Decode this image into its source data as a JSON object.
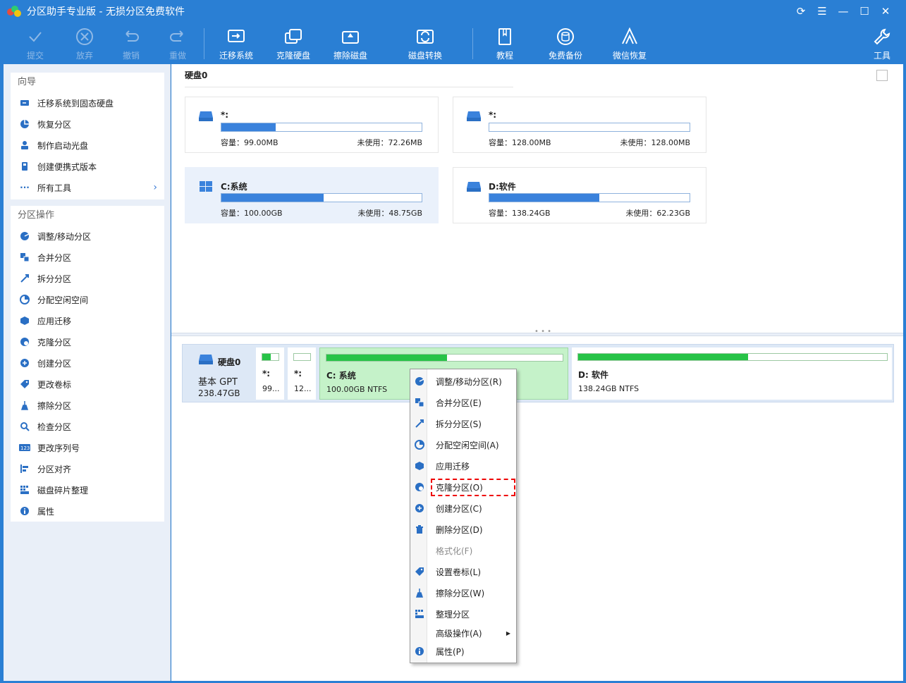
{
  "window": {
    "title": "分区助手专业版 - 无损分区免费软件"
  },
  "toolbar": {
    "commit": "提交",
    "discard": "放弃",
    "undo": "撤销",
    "redo": "重做",
    "migrate": "迁移系统",
    "clone": "克隆硬盘",
    "wipe": "擦除磁盘",
    "convert": "磁盘转换",
    "tutorial": "教程",
    "backup": "免费备份",
    "wechat": "微信恢复",
    "tools": "工具"
  },
  "sidebar": {
    "wizard_title": "向导",
    "wizard_items": [
      "迁移系统到固态硬盘",
      "恢复分区",
      "制作启动光盘",
      "创建便携式版本",
      "所有工具"
    ],
    "ops_title": "分区操作",
    "ops_items": [
      "调整/移动分区",
      "合并分区",
      "拆分分区",
      "分配空闲空间",
      "应用迁移",
      "克隆分区",
      "创建分区",
      "更改卷标",
      "擦除分区",
      "检查分区",
      "更改序列号",
      "分区对齐",
      "磁盘碎片整理",
      "属性"
    ]
  },
  "main": {
    "disk_title": "硬盘0",
    "partitions": [
      {
        "name": "*:",
        "used_fraction": 0.27,
        "capacity_label": "容量：99.00MB",
        "free_label": "未使用：72.26MB"
      },
      {
        "name": "*:",
        "used_fraction": 0.0,
        "capacity_label": "容量：128.00MB",
        "free_label": "未使用：128.00MB"
      },
      {
        "name": "C:系统",
        "used_fraction": 0.51,
        "capacity_label": "容量：100.00GB",
        "free_label": "未使用：48.75GB"
      },
      {
        "name": "D:软件",
        "used_fraction": 0.55,
        "capacity_label": "容量：138.24GB",
        "free_label": "未使用：62.23GB"
      }
    ]
  },
  "diskmap": {
    "name": "硬盘0",
    "type": "基本 GPT",
    "size": "238.47GB",
    "segments": [
      {
        "name": "*:",
        "info": "99...",
        "used_fraction": 0.5
      },
      {
        "name": "*:",
        "info": "12...",
        "used_fraction": 0.0
      },
      {
        "name": "C: 系统",
        "info": "100.00GB NTFS",
        "used_fraction": 0.51
      },
      {
        "name": "D: 软件",
        "info": "138.24GB NTFS",
        "used_fraction": 0.55
      }
    ]
  },
  "context_menu": {
    "items": [
      "调整/移动分区(R)",
      "合并分区(E)",
      "拆分分区(S)",
      "分配空闲空间(A)",
      "应用迁移",
      "克隆分区(O)",
      "创建分区(C)",
      "删除分区(D)",
      "格式化(F)",
      "设置卷标(L)",
      "擦除分区(W)",
      "整理分区",
      "高级操作(A)",
      "属性(P)"
    ]
  },
  "colors": {
    "accent": "#2a7fd4",
    "bar_blue": "#3a82dc",
    "bar_green": "#27c347",
    "highlight": "#e00000"
  }
}
